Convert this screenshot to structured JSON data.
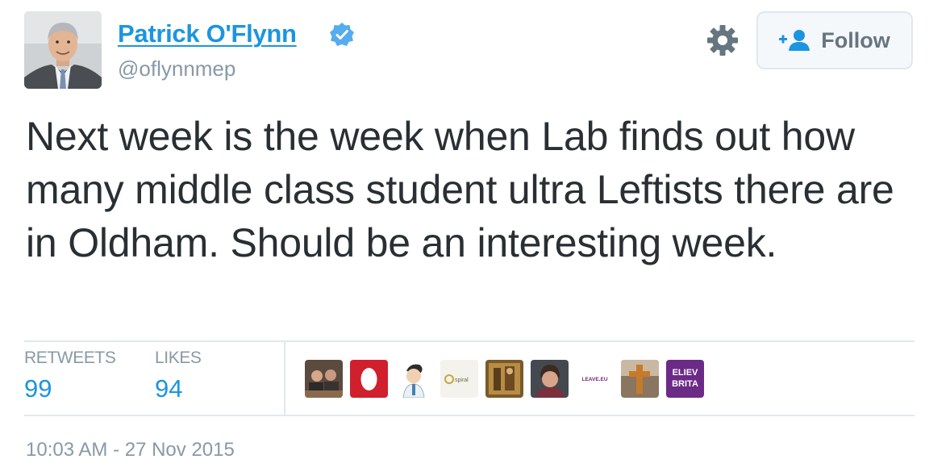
{
  "author": {
    "name": "Patrick O'Flynn",
    "handle": "@oflynnmep",
    "verified": true
  },
  "actions": {
    "settings_icon": "gear-icon",
    "follow_label": "Follow",
    "follow_icon": "add-user-icon"
  },
  "tweet": {
    "text": "Next week is the week when Lab finds out how many middle class student ultra Leftists there are in Oldham. Should be an interesting week.",
    "timestamp": "10:03 AM - 27 Nov 2015"
  },
  "stats": {
    "retweets_label": "RETWEETS",
    "retweets_count": "99",
    "likes_label": "LIKES",
    "likes_count": "94"
  },
  "liker_avatar_texts": {
    "spiral": "spiral",
    "leave": "LEAVE.EU",
    "believe": "ELIEV",
    "britain": "BRITA"
  },
  "colors": {
    "link_blue": "#1b95e0",
    "text": "#292f33",
    "muted": "#8899a6",
    "border": "#e1e8ed"
  }
}
